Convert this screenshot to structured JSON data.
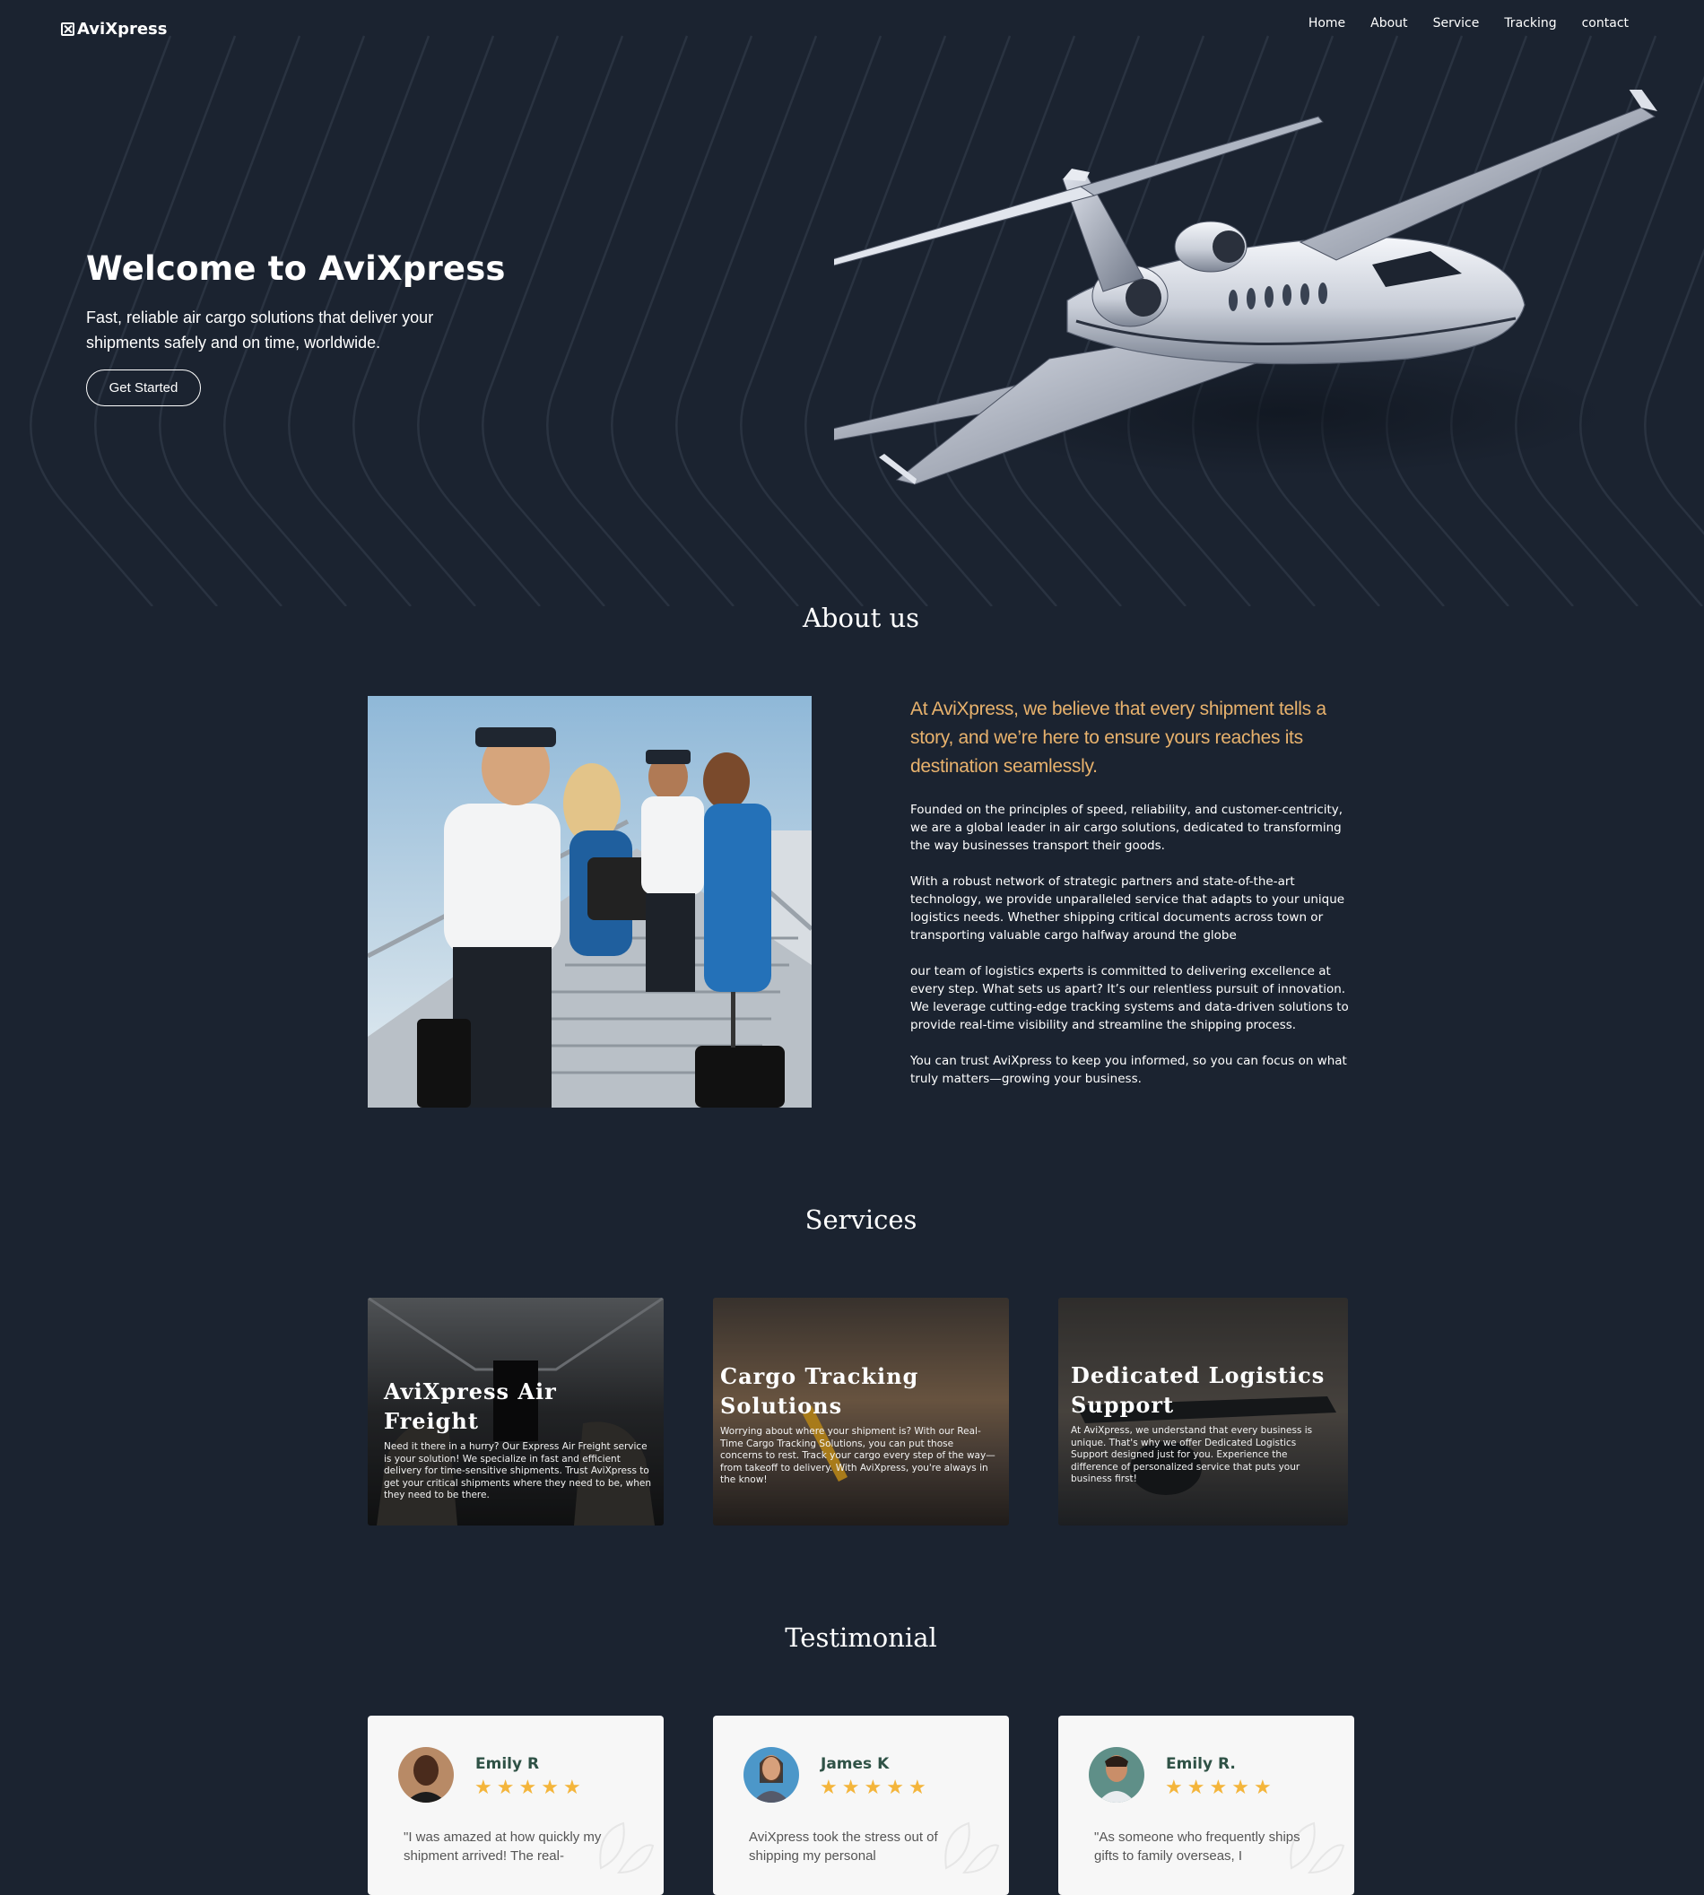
{
  "nav": {
    "brand": "AviXpress",
    "links": [
      "Home",
      "About",
      "Service",
      "Tracking",
      "contact"
    ]
  },
  "hero": {
    "title": "Welcome to AviXpress",
    "subtitle": "Fast, reliable air cargo solutions that deliver your shipments safely and on time, worldwide.",
    "cta_label": "Get Started"
  },
  "about": {
    "heading": "About us",
    "lead": "At AviXpress, we believe that every shipment tells a story, and we’re here to ensure yours reaches its destination seamlessly.",
    "paragraphs": [
      "Founded on the principles of speed, reliability, and customer-centricity, we are a global leader in air cargo solutions, dedicated to transforming the way businesses transport their goods.",
      "With a robust network of strategic partners and state-of-the-art technology, we provide unparalleled service that adapts to your unique logistics needs. Whether shipping critical documents across town or transporting valuable cargo halfway around the globe",
      "our team of logistics experts is committed to delivering excellence at every step. What sets us apart? It’s our relentless pursuit of innovation. We leverage cutting-edge tracking systems and data-driven solutions to provide real-time visibility and streamline the shipping process.",
      "You can trust AviXpress to keep you informed, so you can focus on what truly matters—growing your business."
    ]
  },
  "services": {
    "heading": "Services",
    "cards": [
      {
        "title": "AviXpress Air Freight",
        "description": "Need it there in a hurry? Our Express Air Freight service is your solution! We specialize in fast and efficient delivery for time-sensitive shipments. Trust AviXpress to get your critical shipments where they need to be, when they need to be there."
      },
      {
        "title": "Cargo Tracking Solutions",
        "description": "Worrying about where your shipment is? With our Real-Time Cargo Tracking Solutions, you can put those concerns to rest. Track your cargo every step of the way—from takeoff to delivery. With AviXpress, you're always in the know!"
      },
      {
        "title": "Dedicated Logistics Support",
        "description": "At AviXpress, we understand that every business is unique. That's why we offer Dedicated Logistics Support designed just for you. Experience the difference of personalized service that puts your business first!"
      }
    ]
  },
  "testimonials": {
    "heading": "Testimonial",
    "items": [
      {
        "name": "Emily R",
        "rating": 5,
        "quote": "\"I was amazed at how quickly my shipment arrived! The real-"
      },
      {
        "name": "James K",
        "rating": 5,
        "quote": "AviXpress took the stress out of shipping my personal"
      },
      {
        "name": "Emily R.",
        "rating": 5,
        "quote": "\"As someone who frequently ships gifts to family overseas, I"
      }
    ]
  },
  "colors": {
    "background": "#1b2330",
    "accent": "#e8b26d",
    "star": "#f4b53b",
    "testimonial_name": "#2f5246"
  }
}
